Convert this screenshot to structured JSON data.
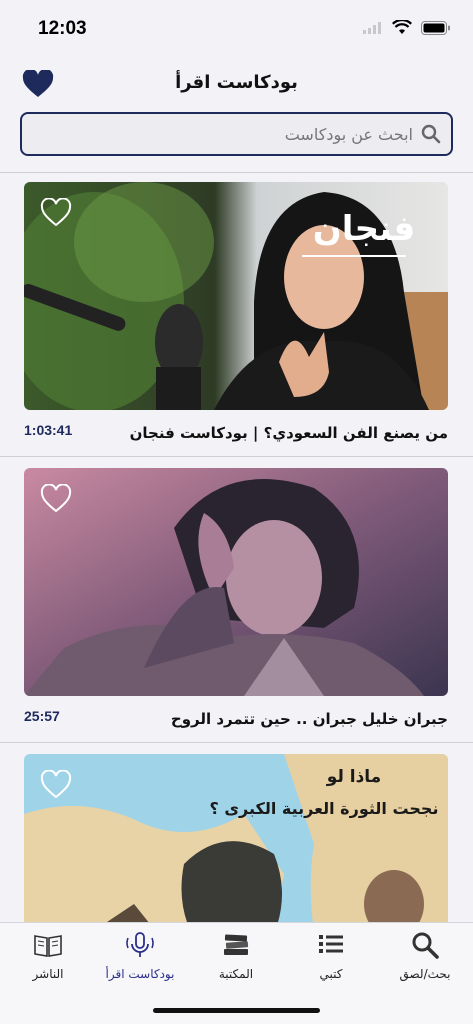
{
  "status_bar": {
    "time": "12:03"
  },
  "header": {
    "title": "بودكاست اقرأ"
  },
  "search": {
    "placeholder": "ابحث عن بودكاست"
  },
  "episodes": [
    {
      "title": "من يصنع الفن السعودي؟ | بودكاست فنجان",
      "duration": "1:03:41",
      "overlay_text": "فنجان"
    },
    {
      "title": "جبران خليل جبران .. حين تتمرد الروح",
      "duration": "25:57"
    },
    {
      "title": "",
      "duration": "",
      "overlay_text": "ماذا لو\nنجحت الثورة العربية الكبرى ؟"
    }
  ],
  "tab_bar": {
    "tabs": [
      {
        "label": "الناشر",
        "icon": "book-open-icon"
      },
      {
        "label": "بودكاست اقرأ",
        "icon": "microphone-icon",
        "active": true
      },
      {
        "label": "المكتبة",
        "icon": "books-stack-icon"
      },
      {
        "label": "كتبي",
        "icon": "list-icon"
      },
      {
        "label": "بحث/لصق",
        "icon": "search-icon"
      }
    ]
  },
  "colors": {
    "accent": "#1f2a5c",
    "active_tab": "#2b2f8a",
    "background": "#f2f2f7"
  }
}
